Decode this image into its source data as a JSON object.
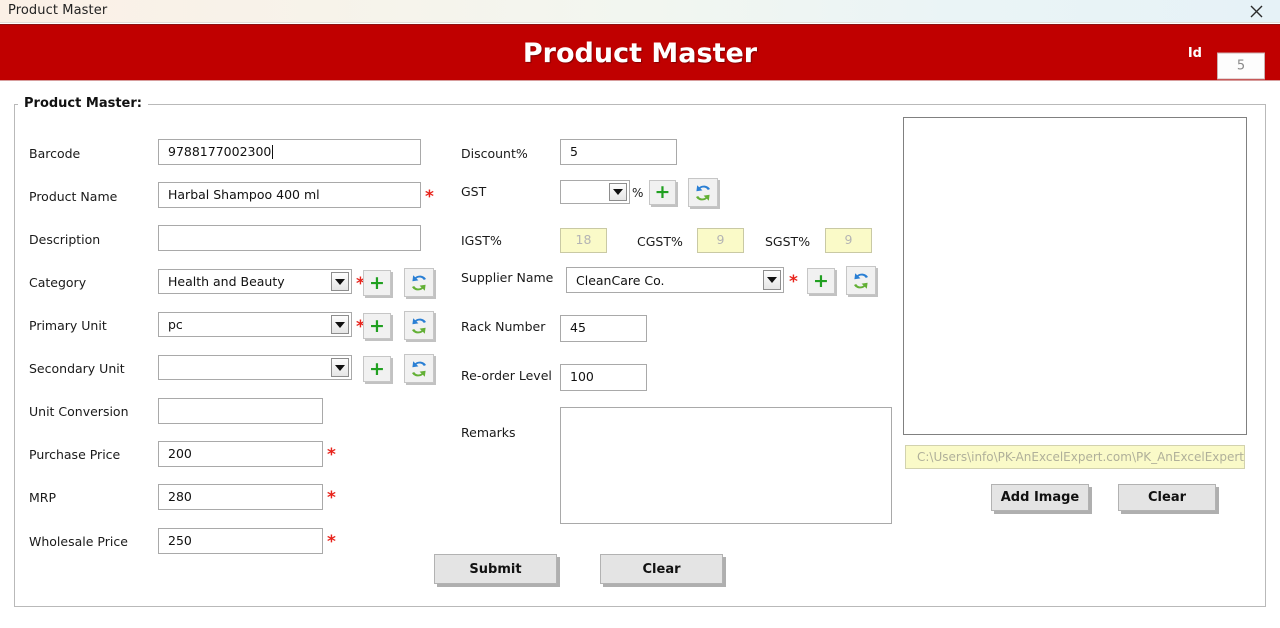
{
  "window": {
    "title": "Product Master",
    "close_icon": "close-icon"
  },
  "banner": {
    "title": "Product Master",
    "id_label": "Id",
    "id_value": "5",
    "color": "#c00000"
  },
  "group": {
    "legend": "Product Master:"
  },
  "left_column": {
    "fields": [
      {
        "label": "Barcode",
        "value": "9788177002300",
        "type": "textbox",
        "required": false,
        "focused": true
      },
      {
        "label": "Product Name",
        "value": "Harbal Shampoo 400 ml",
        "type": "textbox",
        "required": true,
        "focused": false
      },
      {
        "label": "Description",
        "value": "",
        "type": "textbox",
        "required": false,
        "focused": false
      },
      {
        "label": "Category",
        "value": "Health and Beauty",
        "type": "combobox",
        "required": true,
        "focused": false
      },
      {
        "label": "Primary Unit",
        "value": "pc",
        "type": "combobox",
        "required": true,
        "focused": false
      },
      {
        "label": "Secondary Unit",
        "value": "",
        "type": "combobox",
        "required": false,
        "focused": false
      },
      {
        "label": "Unit Conversion",
        "value": "",
        "type": "textbox",
        "required": false,
        "focused": false
      },
      {
        "label": "Purchase Price",
        "value": "200",
        "type": "textbox",
        "required": true,
        "focused": false
      },
      {
        "label": "MRP",
        "value": "280",
        "type": "textbox",
        "required": true,
        "focused": false
      },
      {
        "label": "Wholesale Price",
        "value": "250",
        "type": "textbox",
        "required": true,
        "focused": false
      }
    ]
  },
  "middle_column": {
    "discount": {
      "label": "Discount%",
      "value": "5"
    },
    "gst": {
      "label": "GST",
      "value": "",
      "percent_sign": "%"
    },
    "tax": {
      "igst": {
        "label": "IGST%",
        "value": "18"
      },
      "cgst": {
        "label": "CGST%",
        "value": "9"
      },
      "sgst": {
        "label": "SGST%",
        "value": "9"
      }
    },
    "supplier": {
      "label": "Supplier Name",
      "value": "CleanCare Co."
    },
    "rack": {
      "label": "Rack Number",
      "value": "45"
    },
    "reorder": {
      "label": "Re-order Level",
      "value": "100"
    },
    "remarks": {
      "label": "Remarks",
      "value": ""
    }
  },
  "icons": {
    "add_icon": "+",
    "refresh_icon": "refresh-icon"
  },
  "buttons": {
    "submit": "Submit",
    "clear": "Clear",
    "add_image": "Add Image",
    "image_clear": "Clear"
  },
  "image_panel": {
    "path_value": "C:\\Users\\info\\PK-AnExcelExpert.com\\PK_AnExcelExpert_Te"
  }
}
